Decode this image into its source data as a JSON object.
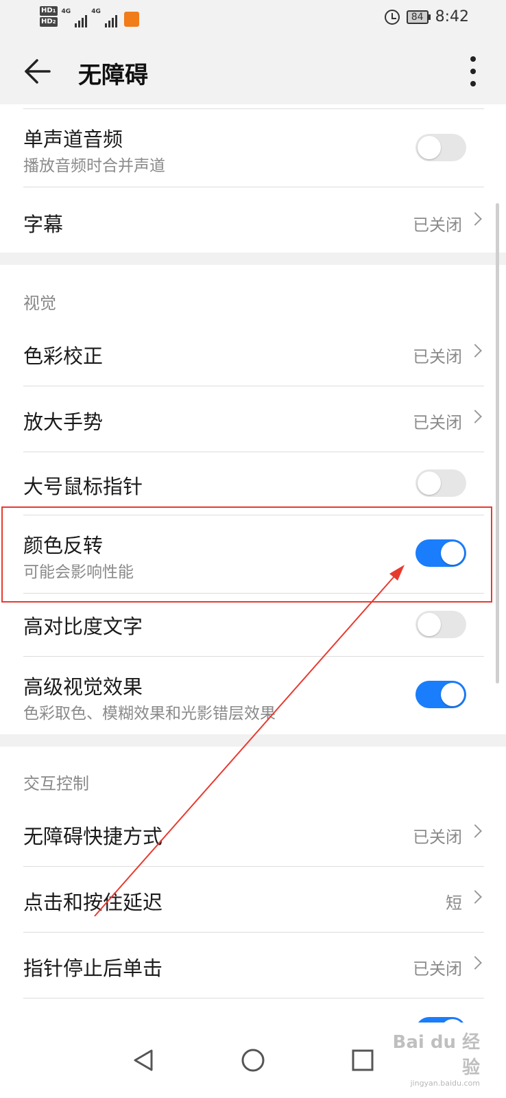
{
  "status_bar": {
    "sim1": "HD",
    "sim1_num": "1",
    "sim2": "HD",
    "sim2_num": "2",
    "network1": "4G",
    "network2": "4G",
    "battery": "84",
    "time": "8:42"
  },
  "app_bar": {
    "title": "无障碍"
  },
  "top_section": {
    "items": [
      {
        "label": "单声道音频",
        "sub": "播放音频时合并声道",
        "toggle": false
      },
      {
        "label": "字幕",
        "value": "已关闭"
      }
    ]
  },
  "visual_section": {
    "header": "视觉",
    "items": [
      {
        "label": "色彩校正",
        "value": "已关闭"
      },
      {
        "label": "放大手势",
        "value": "已关闭"
      },
      {
        "label": "大号鼠标指针",
        "toggle": false
      },
      {
        "label": "颜色反转",
        "sub": "可能会影响性能",
        "toggle": true
      },
      {
        "label": "高对比度文字",
        "toggle": false
      },
      {
        "label": "高级视觉效果",
        "sub": "色彩取色、模糊效果和光影错层效果",
        "toggle": true
      }
    ]
  },
  "interaction_section": {
    "header": "交互控制",
    "items": [
      {
        "label": "无障碍快捷方式",
        "value": "已关闭"
      },
      {
        "label": "点击和按住延迟",
        "value": "短"
      },
      {
        "label": "指针停止后单击",
        "value": "已关闭"
      }
    ]
  },
  "watermark": {
    "text": "Bai du 经验",
    "url": "jingyan.baidu.com"
  },
  "colors": {
    "accent": "#1a7dfb",
    "highlight": "#e8392f",
    "bar": "#f2f2f2"
  }
}
